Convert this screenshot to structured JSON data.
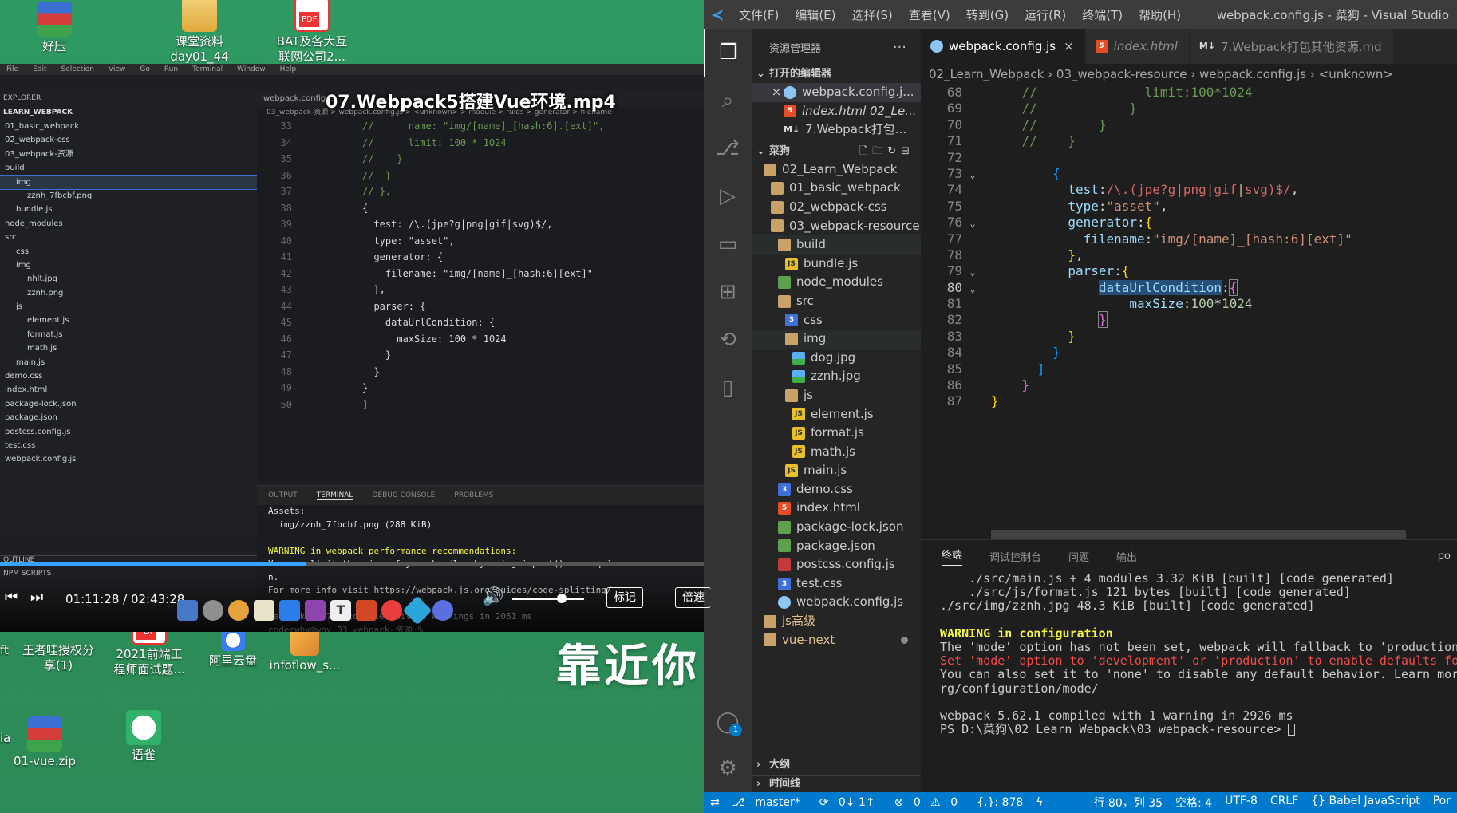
{
  "desktop": {
    "icons_top": [
      {
        "label": "好压",
        "kind": "rar"
      },
      {
        "label": "课堂资料\nday01_44",
        "kind": "folder"
      },
      {
        "label": "BAT及各大互\n联网公司2...",
        "kind": "pdf"
      }
    ],
    "icons_bottom": [
      {
        "label": "王者哇授权分\n享(1)",
        "kind": "none"
      },
      {
        "label": "2021前端工\n程师面试题...",
        "kind": "pdf"
      },
      {
        "label": "阿里云盘",
        "kind": "cloud"
      },
      {
        "label": "infoflow_s...",
        "kind": "box"
      },
      {
        "label": "01-vue.zip",
        "kind": "rar"
      },
      {
        "label": "语雀",
        "kind": "yuque"
      }
    ],
    "edge_labels": [
      "ft",
      "ia"
    ],
    "calligraphy": "靠近你"
  },
  "video": {
    "title": "07.Webpack5搭建Vue环境.mp4",
    "menu": [
      "File",
      "Edit",
      "Selection",
      "View",
      "Go",
      "Run",
      "Terminal",
      "Window",
      "Help"
    ],
    "explorer_header": "EXPLORER",
    "project": "LEARN_WEBPACK",
    "tree": [
      "01_basic_webpack",
      "02_webpack-css",
      "03_webpack-资源",
      "build",
      "img",
      "zznh_7fbcbf.png",
      "bundle.js",
      "node_modules",
      "src",
      "css",
      "img",
      "nhlt.jpg",
      "zznh.png",
      "js",
      "element.js",
      "format.js",
      "math.js",
      "main.js",
      "demo.css",
      "index.html",
      "package-lock.json",
      "package.json",
      "postcss.config.js",
      "test.css",
      "webpack.config.js"
    ],
    "outline_label": "OUTLINE",
    "npm_label": "NPM SCRIPTS",
    "tab_label": "webpack.config.js",
    "breadcrumb": "03_webpack-资源 > webpack.config.js > <unknown> > module > rules > generator > filename",
    "line_numbers": [
      "33",
      "34",
      "35",
      "36",
      "37",
      "38",
      "39",
      "40",
      "41",
      "42",
      "43",
      "44",
      "45",
      "46",
      "47",
      "48",
      "49",
      "50"
    ],
    "code_lines": [
      "//      name: \"img/[name]_[hash:6].[ext]\",",
      "//      limit: 100 * 1024",
      "//    }",
      "//  }",
      "// },",
      "{",
      "  test: /\\.(jpe?g|png|gif|svg)$/,",
      "  type: \"asset\",",
      "  generator: {",
      "    filename: \"img/[name]_[hash:6][ext]\"",
      "  },",
      "  parser: {",
      "    dataUrlCondition: {",
      "      maxSize: 100 * 1024",
      "    }",
      "  }",
      "}",
      "]"
    ],
    "term_tabs": [
      "OUTPUT",
      "TERMINAL",
      "DEBUG CONSOLE",
      "PROBLEMS"
    ],
    "term_lines": [
      "Assets:",
      "  img/zznh_7fbcbf.png (288 KiB)",
      "",
      "WARNING in webpack performance recommendations:",
      "You can limit the size of your bundles by using import() or require.ensure",
      "n.",
      "For more info visit https://webpack.js.org/guides/code-splitting/",
      "",
      "webpack 5.37.1 compiled with 3 warnings in 2061 ms",
      "coderwhy@why 03_webpack-资源 %"
    ],
    "time": "01:11:28 / 02:43:28",
    "progress_fraction": 0.435,
    "volume_fraction": 0.62,
    "btn_mark": "标记",
    "btn_speed": "倍速"
  },
  "vscode": {
    "menu": [
      "文件(F)",
      "编辑(E)",
      "选择(S)",
      "查看(V)",
      "转到(G)",
      "运行(R)",
      "终端(T)",
      "帮助(H)"
    ],
    "window_title": "webpack.config.js - 菜狗 - Visual Studio",
    "explorer_title": "资源管理器",
    "more": "···",
    "open_editors_label": "打开的编辑器",
    "open_editors": [
      {
        "name": "webpack.config.j...",
        "icon": "webpack",
        "dirty": false
      },
      {
        "name": "index.html  02_Le...",
        "icon": "html",
        "dirty": false
      },
      {
        "name": "7.Webpack打包...",
        "icon": "md",
        "dirty": false
      }
    ],
    "workspace_label": "菜狗",
    "tree": [
      {
        "name": "02_Learn_Webpack",
        "icon": "folder",
        "indent": 1
      },
      {
        "name": "01_basic_webpack",
        "icon": "folder",
        "indent": 2
      },
      {
        "name": "02_webpack-css",
        "icon": "folder",
        "indent": 2
      },
      {
        "name": "03_webpack-resource",
        "icon": "folder",
        "indent": 2
      },
      {
        "name": "build",
        "icon": "folder",
        "indent": 3,
        "hl": true
      },
      {
        "name": "bundle.js",
        "icon": "js",
        "indent": 4
      },
      {
        "name": "node_modules",
        "icon": "node",
        "indent": 3
      },
      {
        "name": "src",
        "icon": "folder",
        "indent": 3
      },
      {
        "name": "css",
        "icon": "css",
        "indent": 4
      },
      {
        "name": "img",
        "icon": "folder",
        "indent": 4,
        "hl": true
      },
      {
        "name": "dog.jpg",
        "icon": "img",
        "indent": 5
      },
      {
        "name": "zznh.jpg",
        "icon": "img",
        "indent": 5
      },
      {
        "name": "js",
        "icon": "folder",
        "indent": 4
      },
      {
        "name": "element.js",
        "icon": "js",
        "indent": 5
      },
      {
        "name": "format.js",
        "icon": "js",
        "indent": 5
      },
      {
        "name": "math.js",
        "icon": "js",
        "indent": 5
      },
      {
        "name": "main.js",
        "icon": "js",
        "indent": 4
      },
      {
        "name": "demo.css",
        "icon": "css",
        "indent": 3
      },
      {
        "name": "index.html",
        "icon": "html",
        "indent": 3
      },
      {
        "name": "package-lock.json",
        "icon": "node",
        "indent": 3
      },
      {
        "name": "package.json",
        "icon": "node",
        "indent": 3
      },
      {
        "name": "postcss.config.js",
        "icon": "pjson",
        "indent": 3
      },
      {
        "name": "test.css",
        "icon": "css",
        "indent": 3
      },
      {
        "name": "webpack.config.js",
        "icon": "webpack",
        "indent": 3
      },
      {
        "name": "js高级",
        "icon": "folder",
        "indent": 1
      },
      {
        "name": "vue-next",
        "icon": "folder",
        "indent": 1,
        "dot": true
      }
    ],
    "outline_label": "大纲",
    "timeline_label": "时间线",
    "tabs": [
      {
        "label": "webpack.config.js",
        "icon": "webpack",
        "active": true,
        "close": "×"
      },
      {
        "label": "index.html",
        "icon": "html",
        "active": false,
        "italic": true
      },
      {
        "label": "7.Webpack打包其他资源.md",
        "icon": "md",
        "active": false
      }
    ],
    "breadcrumb": [
      "02_Learn_Webpack",
      "03_webpack-resource",
      "webpack.config.js",
      "<unknown>"
    ],
    "line_numbers": [
      "68",
      "69",
      "70",
      "71",
      "72",
      "73",
      "74",
      "75",
      "76",
      "77",
      "78",
      "79",
      "80",
      "81",
      "82",
      "83",
      "84",
      "85",
      "86",
      "87"
    ],
    "current_line": "80",
    "panel_tabs": [
      "终端",
      "调试控制台",
      "问题",
      "输出"
    ],
    "panel_right": "po",
    "terminal": [
      "    ./src/main.js + 4 modules 3.32 KiB [built] [code generated]",
      "    ./src/js/format.js 121 bytes [built] [code generated]",
      "./src/img/zznh.jpg 48.3 KiB [built] [code generated]",
      "",
      "WARNING in configuration",
      "The 'mode' option has not been set, webpack will fallback to 'production",
      "Set 'mode' option to 'development' or 'production' to enable defaults fo",
      "You can also set it to 'none' to disable any default behavior. Learn mor",
      "rg/configuration/mode/",
      "",
      "webpack 5.62.1 compiled with 1 warning in 2926 ms",
      "PS D:\\菜狗\\02_Learn_Webpack\\03_webpack-resource> "
    ],
    "status": {
      "branch": "master*",
      "sync": "0↓ 1↑",
      "errors": "0",
      "warnings": "0",
      "extra": "{.}: 878",
      "position": "行 80，列 35",
      "spaces": "空格: 4",
      "encoding": "UTF-8",
      "eol": "CRLF",
      "language": "{} Babel JavaScript",
      "tail": "Por"
    },
    "account_badge": "1"
  }
}
